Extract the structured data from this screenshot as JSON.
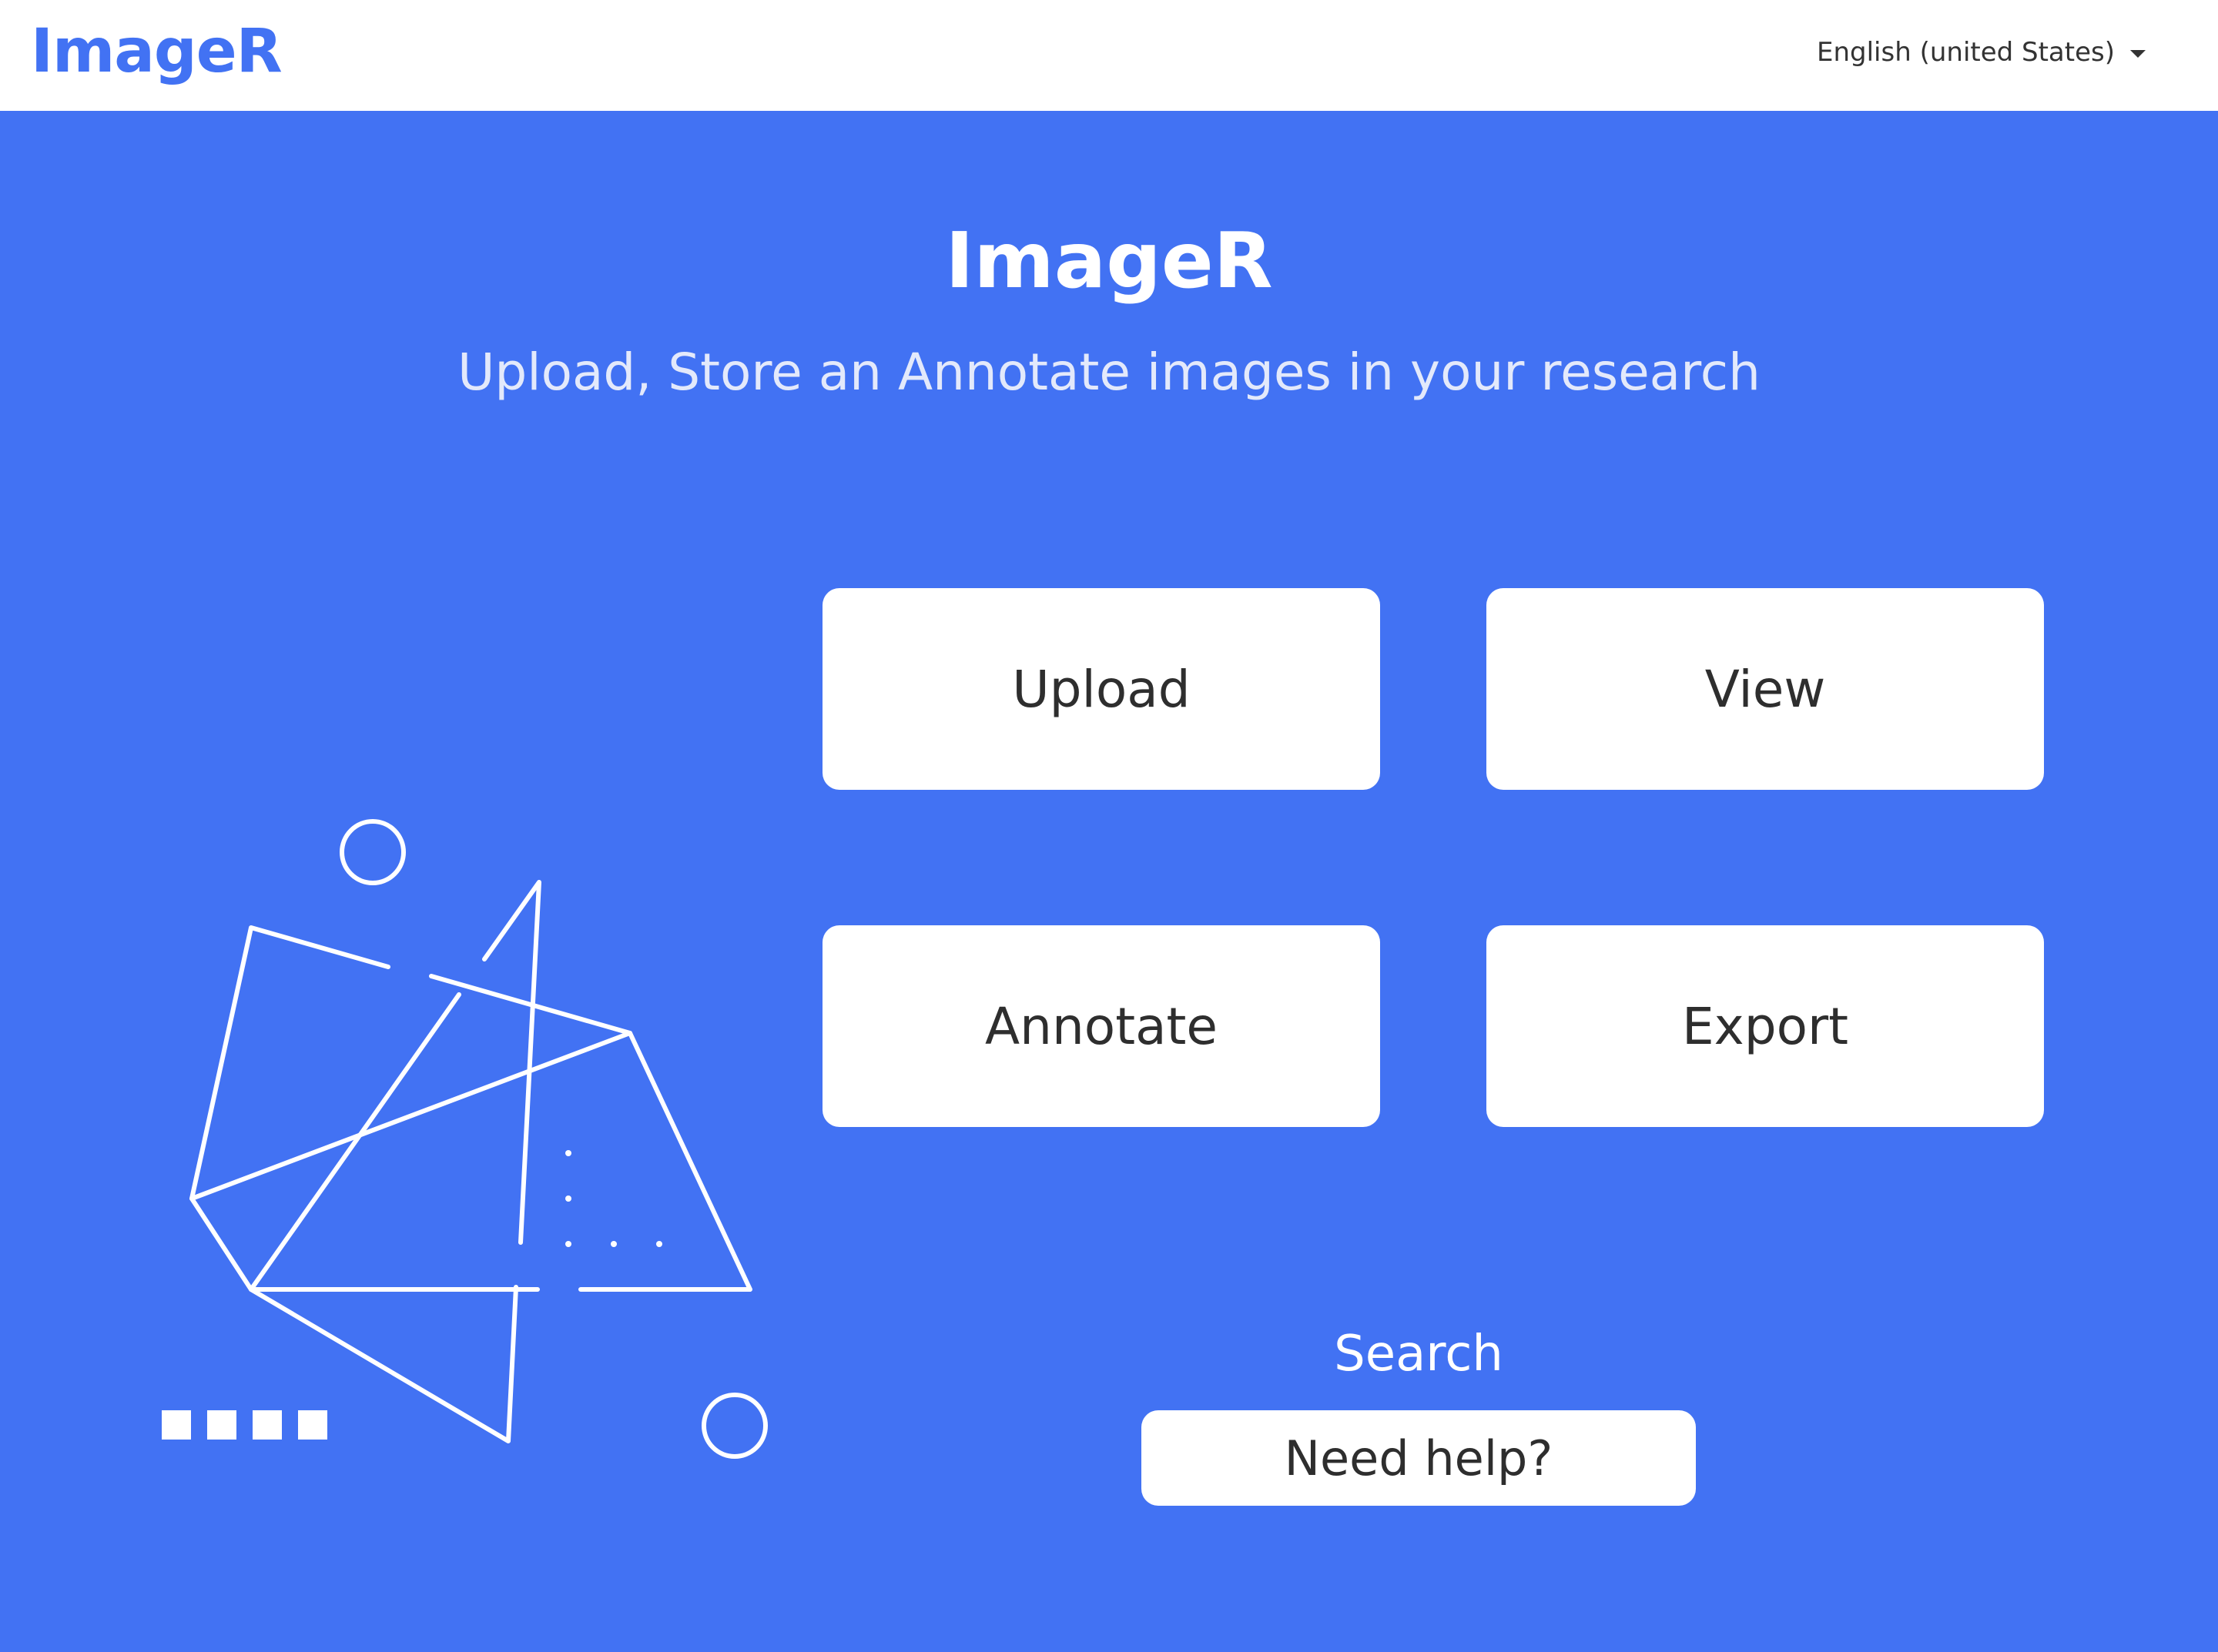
{
  "header": {
    "logo": "ImageR",
    "language": "English (united States)",
    "language_icon": "caret-down-icon"
  },
  "hero": {
    "title": "ImageR",
    "subtitle": "Upload, Store an Annotate images in your research"
  },
  "actions": {
    "upload": "Upload",
    "view": "View",
    "annotate": "Annotate",
    "export": "Export"
  },
  "search": {
    "label": "Search",
    "help_label": "Need help?"
  },
  "colors": {
    "brand": "#4272F3",
    "card": "#FFFFFF",
    "text": "#2E2E2E"
  }
}
